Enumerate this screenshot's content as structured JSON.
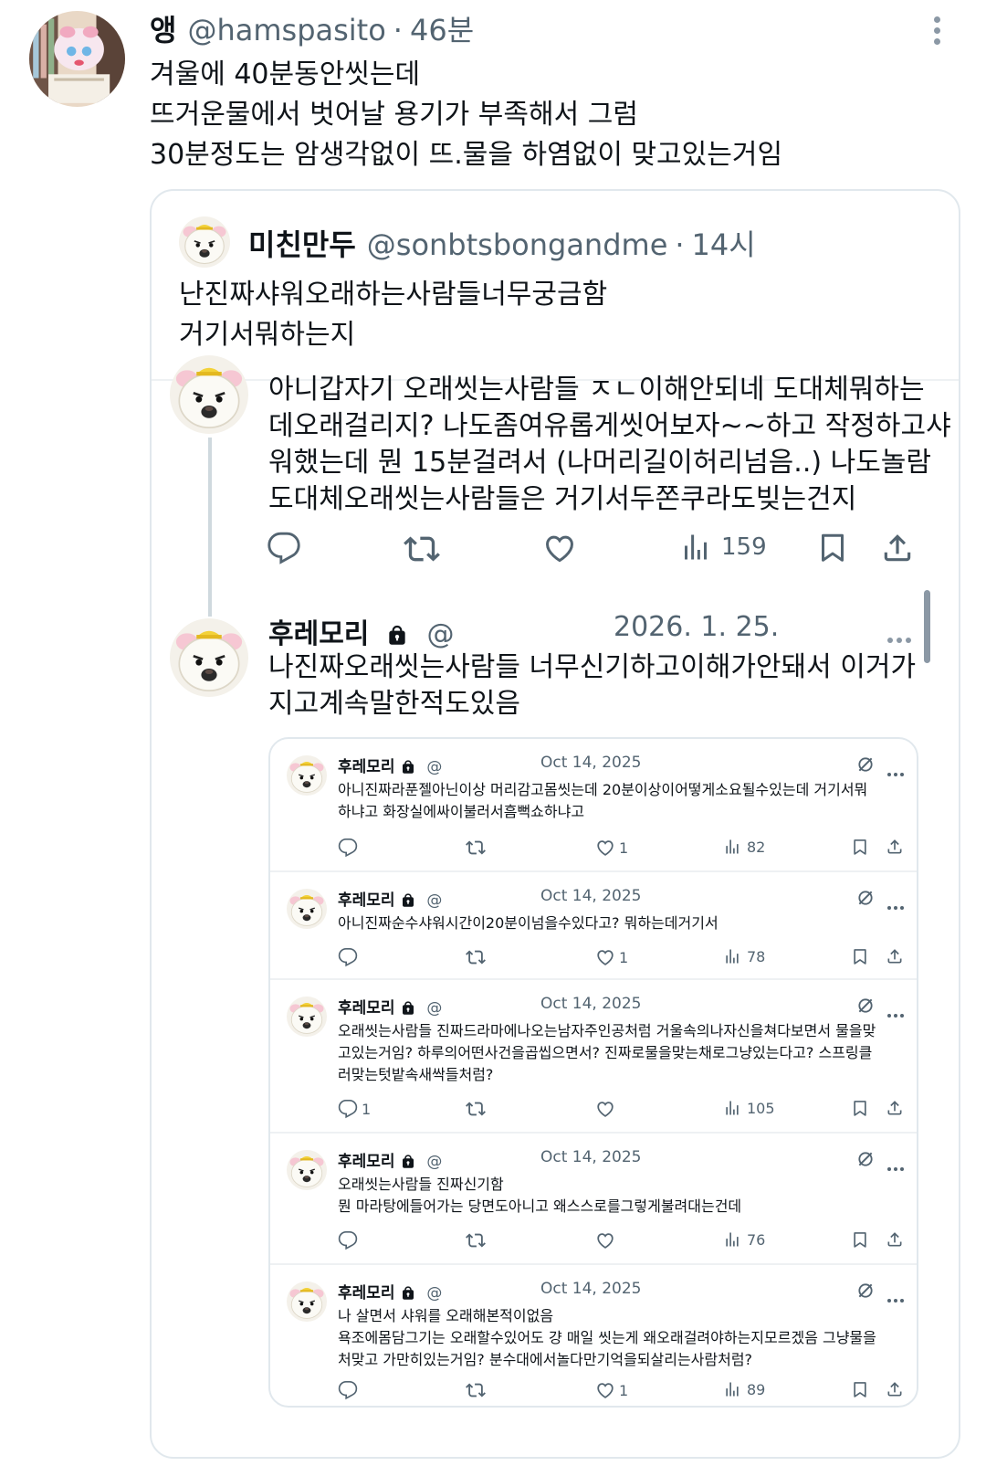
{
  "main_tweet": {
    "name": "앵",
    "handle": "@hamspasito",
    "time": "46분",
    "dot": "·",
    "lines": [
      "겨울에 40분동안씻는데",
      "뜨거운물에서 벗어날 용기가 부족해서 그럼",
      "30분정도는 암생각없이 뜨.물을 하염없이 맞고있는거임"
    ]
  },
  "quote_tweet": {
    "name": "미친만두",
    "handle": "@sonbtsbongandme",
    "time": "14시",
    "dot": "·",
    "lines": [
      "난진짜샤워오래하는사람들너무궁금함",
      "거기서뭐하는지"
    ]
  },
  "thread_tweet": {
    "lines": [
      "아니갑자기 오래씻는사람들 ㅈㄴ이해안되네 도대체뭐하는",
      "데오래걸리지? 나도좀여유롭게씻어보자~~하고 작정하고샤",
      "워했는데 뭔 15분걸려서 (나머리길이허리넘음..) 나도놀람",
      "도대체오래씻는사람들은 거기서두쫀쿠라도빚는건지"
    ],
    "views": "159"
  },
  "reply_tweet": {
    "name": "후레모리",
    "handle": "@",
    "date": "2026. 1. 25.",
    "lines": [
      "나진짜오래씻는사람들 너무신기하고이해가안돼서 이거가",
      "지고계속말한적도있음"
    ]
  },
  "embedded_tweets": [
    {
      "name": "후레모리",
      "handle": "@",
      "date": "Oct 14, 2025",
      "lines": [
        "아니진짜라푼젤아닌이상 머리감고몸씻는데 20분이상이어떻게소요될수있는데 거기서뭐",
        "하냐고 화장실에싸이불러서흠뻑쇼하냐고"
      ],
      "replies": "",
      "likes": "1",
      "views": "82"
    },
    {
      "name": "후레모리",
      "handle": "@",
      "date": "Oct 14, 2025",
      "lines": [
        "아니진짜순수샤워시간이20분이넘을수있다고? 뭐하는데거기서"
      ],
      "replies": "",
      "likes": "1",
      "views": "78"
    },
    {
      "name": "후레모리",
      "handle": "@",
      "date": "Oct 14, 2025",
      "lines": [
        "오래씻는사람들 진짜드라마에나오는남자주인공처럼 거울속의나자신을쳐다보면서 물을맞",
        "고있는거임? 하루의어떤사건을곱씹으면서? 진짜로물을맞는채로그냥있는다고? 스프링클",
        "러맞는텃밭속새싹들처럼?"
      ],
      "replies": "1",
      "likes": "",
      "views": "105"
    },
    {
      "name": "후레모리",
      "handle": "@",
      "date": "Oct 14, 2025",
      "lines": [
        "오래씻는사람들 진짜신기함",
        "뭔 마라탕에들어가는 당면도아니고 왜스스로를그렇게불려대는건데"
      ],
      "replies": "",
      "likes": "",
      "views": "76"
    },
    {
      "name": "후레모리",
      "handle": "@",
      "date": "Oct 14, 2025",
      "lines": [
        "나 살면서 샤워를 오래해본적이없음",
        "욕조에몸담그기는 오래할수있어도 걍 매일 씻는게 왜오래걸려야하는지모르겠음 그냥물을",
        "처맞고 가만히있는거임? 분수대에서놀다만기억을되살리는사람처럼?"
      ],
      "replies": "",
      "likes": "1",
      "views": "89"
    }
  ],
  "icons": {
    "reply": "reply-icon",
    "retweet": "retweet-icon",
    "like": "like-icon",
    "views": "views-icon",
    "bookmark": "bookmark-icon",
    "share": "share-icon",
    "lock": "lock-icon",
    "grok": "grok-icon",
    "more": "more-icon"
  },
  "colors": {
    "text": "#0f1419",
    "secondary": "#536471",
    "border": "#e1e8ed",
    "thread_line": "#cfd9de"
  }
}
